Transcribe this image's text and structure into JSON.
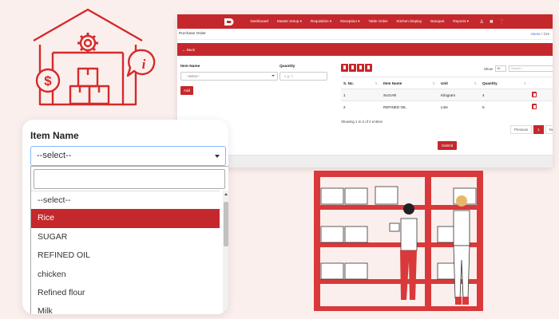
{
  "colors": {
    "brand_red": "#c5282c",
    "light_pink": "#fbefed"
  },
  "navbar": {
    "items": [
      "Dashboard",
      "Master Setup ▾",
      "Requisition ▾",
      "Reception ▾",
      "Table Order",
      "Kitchen Display",
      "Banquet",
      "Reports ▾"
    ],
    "icons": [
      "user-icon",
      "tools-icon",
      "help-icon"
    ]
  },
  "page": {
    "title": "Purchase Order",
    "breadcrumb_home": "Home",
    "breadcrumb_sep": "/",
    "breadcrumb_current": "Cre",
    "back_label": "← Back"
  },
  "form": {
    "item_name_label": "Item Name",
    "item_select_value": "--select--",
    "quantity_label": "Quantity",
    "quantity_placeholder": "e.g. 1",
    "add_label": "Add"
  },
  "table": {
    "show_label": "Show",
    "show_value": "10",
    "search_placeholder": "Search:",
    "columns": [
      "S. No.",
      "Item Name",
      "Unit",
      "Quantity"
    ],
    "rows": [
      {
        "sno": "1",
        "item": "SUGAR",
        "unit": "Kilogram",
        "qty": "4"
      },
      {
        "sno": "2",
        "item": "REFINED OIL",
        "unit": "Litre",
        "qty": "5"
      }
    ],
    "info": "Showing 1 to 2 of 2 entries",
    "pager": {
      "prev": "Previous",
      "current": "1",
      "next": "Next"
    }
  },
  "submit_label": "Submit",
  "zoom": {
    "label": "Item Name",
    "select_value": "--select--",
    "options": [
      "--select--",
      "Rice",
      "SUGAR",
      "REFINED OIL",
      "chicken",
      "Refined flour",
      "Milk"
    ],
    "highlighted_index": 1
  }
}
